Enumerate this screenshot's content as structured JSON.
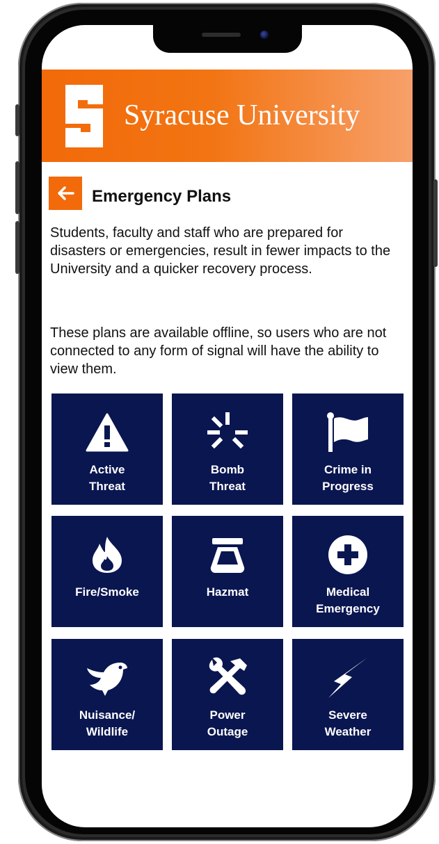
{
  "header": {
    "brand": "Syracuse University"
  },
  "page": {
    "back_label": "←",
    "title": "Emergency Plans",
    "intro": "Students, faculty and staff who are prepared for disasters or emergencies, result in fewer impacts to the University and a quicker recovery process.",
    "offline_note": "These plans are available offline, so users who are not connected to any form of signal will have the ability to view them."
  },
  "tiles": [
    {
      "label": "Active\nThreat",
      "icon": "warning-icon"
    },
    {
      "label": "Bomb\nThreat",
      "icon": "burst-icon"
    },
    {
      "label": "Crime in\nProgress",
      "icon": "flag-icon"
    },
    {
      "label": "Fire/Smoke",
      "icon": "flame-icon"
    },
    {
      "label": "Hazmat",
      "icon": "hazmat-icon"
    },
    {
      "label": "Medical\nEmergency",
      "icon": "medical-plus-icon"
    },
    {
      "label": "Nuisance/\nWildlife",
      "icon": "bird-icon"
    },
    {
      "label": "Power\nOutage",
      "icon": "tools-icon"
    },
    {
      "label": "Severe\nWeather",
      "icon": "lightning-icon"
    }
  ],
  "colors": {
    "brand_orange": "#f26a0a",
    "tile_navy": "#0a1650"
  }
}
